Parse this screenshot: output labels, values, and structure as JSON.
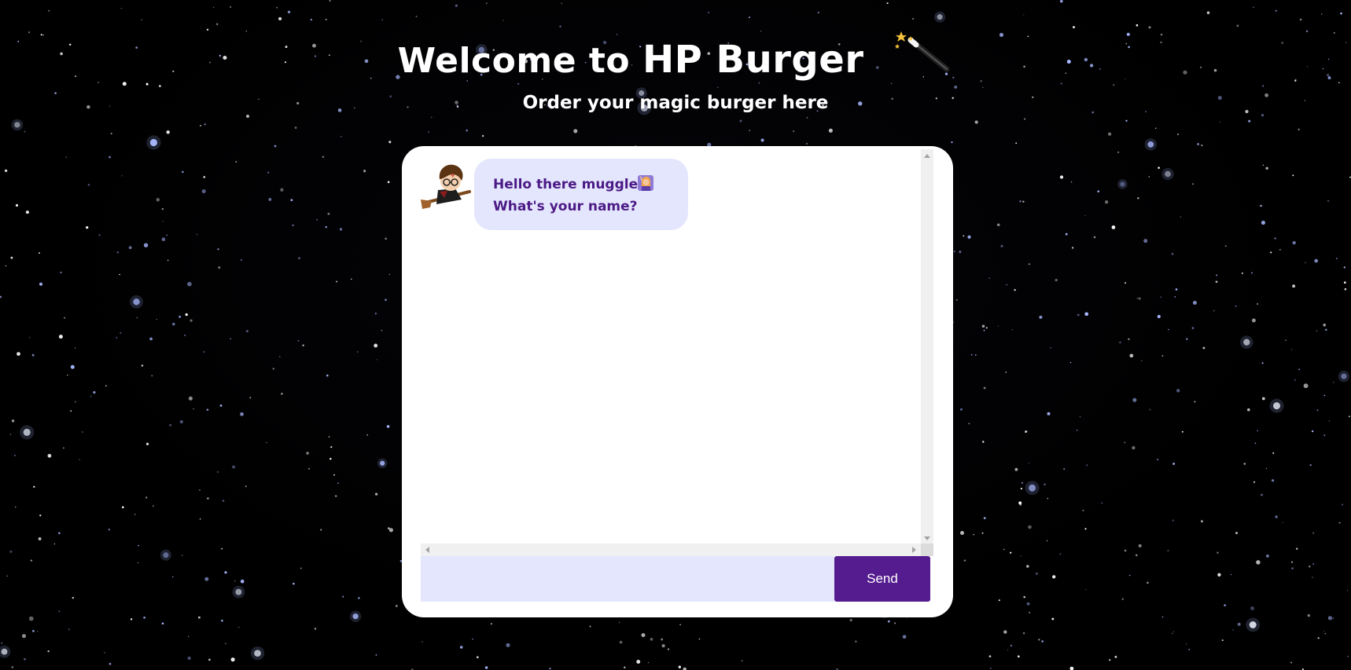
{
  "header": {
    "title_prefix": "Welcome to",
    "title_brand": "HP Burger",
    "title_icon": "magic-wand-icon",
    "subtitle": "Order your magic burger here"
  },
  "chat": {
    "messages": [
      {
        "sender": "bot",
        "avatar_icon": "wizard-on-broom-avatar",
        "lines": [
          "Hello there muggle",
          "What's your name?"
        ],
        "emoji_icon": "person-raising-hand-icon"
      }
    ],
    "input": {
      "value": "",
      "placeholder": ""
    },
    "send_label": "Send"
  },
  "colors": {
    "background": "#000000",
    "card": "#ffffff",
    "bubble_bg": "#e4e6fd",
    "bubble_text": "#4c1a86",
    "input_bg": "#e4e6fd",
    "send_bg": "#541c8f",
    "send_text": "#ffffff",
    "star_tint": "#a9b8ff"
  }
}
